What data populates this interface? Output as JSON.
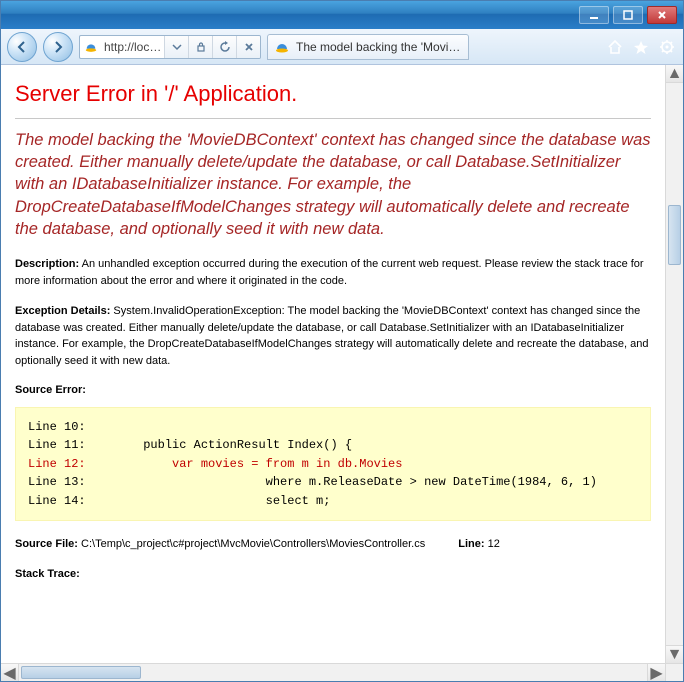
{
  "window": {
    "url": "http://loc…"
  },
  "tab": {
    "title": "The model backing the 'Movi…"
  },
  "error": {
    "title": "Server Error in '/' Application.",
    "message": "The model backing the 'MovieDBContext' context has changed since the database was created. Either manually delete/update the database, or call Database.SetInitializer with an IDatabaseInitializer instance. For example, the DropCreateDatabaseIfModelChanges strategy will automatically delete and recreate the database, and optionally seed it with new data.",
    "description_label": "Description:",
    "description_text": "An unhandled exception occurred during the execution of the current web request. Please review the stack trace for more information about the error and where it originated in the code.",
    "exception_label": "Exception Details:",
    "exception_text": "System.InvalidOperationException: The model backing the 'MovieDBContext' context has changed since the database was created. Either manually delete/update the database, or call Database.SetInitializer with an IDatabaseInitializer instance. For example, the DropCreateDatabaseIfModelChanges strategy will automatically delete and recreate the database, and optionally seed it with new data.",
    "source_error_label": "Source Error:",
    "code": {
      "l10": "Line 10:",
      "l11": "Line 11:        public ActionResult Index() {",
      "l12": "Line 12:            var movies = from m in db.Movies",
      "l13": "Line 13:                         where m.ReleaseDate > new DateTime(1984, 6, 1)",
      "l14": "Line 14:                         select m;"
    },
    "source_file_label": "Source File:",
    "source_file_path": "C:\\Temp\\c_project\\c#project\\MvcMovie\\Controllers\\MoviesController.cs",
    "line_label": "Line:",
    "line_number": "12",
    "stack_trace_label": "Stack Trace:"
  }
}
